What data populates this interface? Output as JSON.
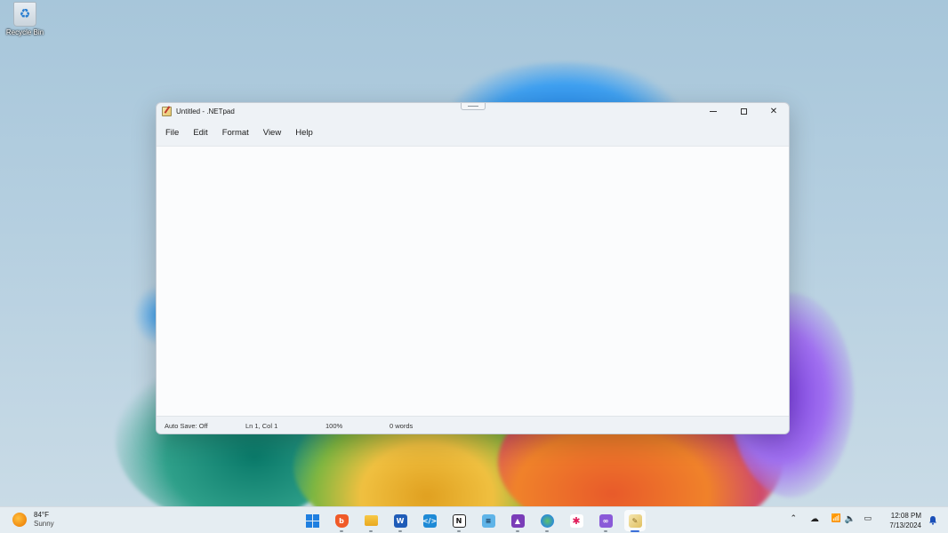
{
  "desktop": {
    "icons": [
      {
        "label": "Recycle Bin",
        "icon": "recycle-bin-icon"
      }
    ]
  },
  "window": {
    "title": "Untitled - .NETpad",
    "menu": [
      "File",
      "Edit",
      "Format",
      "View",
      "Help"
    ],
    "editor_text": "",
    "status": {
      "autosave": "Auto Save: Off",
      "position": "Ln 1, Col 1",
      "zoom": "100%",
      "words": "0 words"
    }
  },
  "taskbar": {
    "weather": {
      "temp": "84°F",
      "condition": "Sunny",
      "icon": "sun-icon"
    },
    "apps": [
      {
        "name": "start",
        "icon": "windows-logo-icon",
        "active": false
      },
      {
        "name": "brave",
        "icon": "brave-icon",
        "active": false
      },
      {
        "name": "file-explorer",
        "icon": "folder-icon",
        "active": false
      },
      {
        "name": "word",
        "icon": "word-icon",
        "active": false
      },
      {
        "name": "vscode",
        "icon": "vscode-icon",
        "active": false
      },
      {
        "name": "notion",
        "icon": "notion-icon",
        "active": false
      },
      {
        "name": "notepad",
        "icon": "notepad-icon",
        "active": false
      },
      {
        "name": "affinity",
        "icon": "affinity-icon",
        "active": false
      },
      {
        "name": "browser",
        "icon": "globe-icon",
        "active": false
      },
      {
        "name": "slack",
        "icon": "slack-icon",
        "active": false
      },
      {
        "name": "visual-studio",
        "icon": "visual-studio-icon",
        "active": false
      },
      {
        "name": "netpad",
        "icon": "netpad-icon",
        "active": true
      }
    ],
    "clock": {
      "time": "12:08 PM",
      "date": "7/13/2024"
    }
  },
  "colors": {
    "accent": "#3b6fd8",
    "window_bg": "#eef2f6",
    "editor_bg": "#fbfcfd"
  }
}
